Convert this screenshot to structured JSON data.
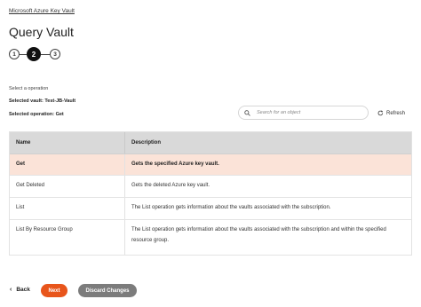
{
  "breadcrumb": "Microsoft Azure Key Vault",
  "page_title": "Query Vault",
  "stepper": {
    "steps": [
      "1",
      "2",
      "3"
    ],
    "active": "2"
  },
  "operation_label": "Select a operation",
  "selected_vault": "Selected vault: Test-JB-Vault",
  "selected_operation": "Selected operation: Get",
  "search": {
    "placeholder": "Search for an object"
  },
  "refresh_label": "Refresh",
  "table": {
    "headers": {
      "name": "Name",
      "description": "Description"
    },
    "rows": [
      {
        "name": "Get",
        "description": "Gets the specified Azure key vault.",
        "selected": true
      },
      {
        "name": "Get Deleted",
        "description": "Gets the deleted Azure key vault.",
        "selected": false
      },
      {
        "name": "List",
        "description": "The List operation gets information about the vaults associated with the subscription.",
        "selected": false
      },
      {
        "name": "List By Resource Group",
        "description": "The List operation gets information about the vaults associated with the subscription and within the specified resource group.",
        "selected": false
      }
    ]
  },
  "footer": {
    "back_label": "Back",
    "next_label": "Next",
    "discard_label": "Discard Changes"
  },
  "colors": {
    "accent": "#e8551b",
    "selected_row": "#fbe3d8",
    "header_bg": "#d9d9d9",
    "discard_bg": "#7c7c7c"
  },
  "icons": [
    "search-icon",
    "refresh-icon",
    "chevron-left-icon"
  ]
}
